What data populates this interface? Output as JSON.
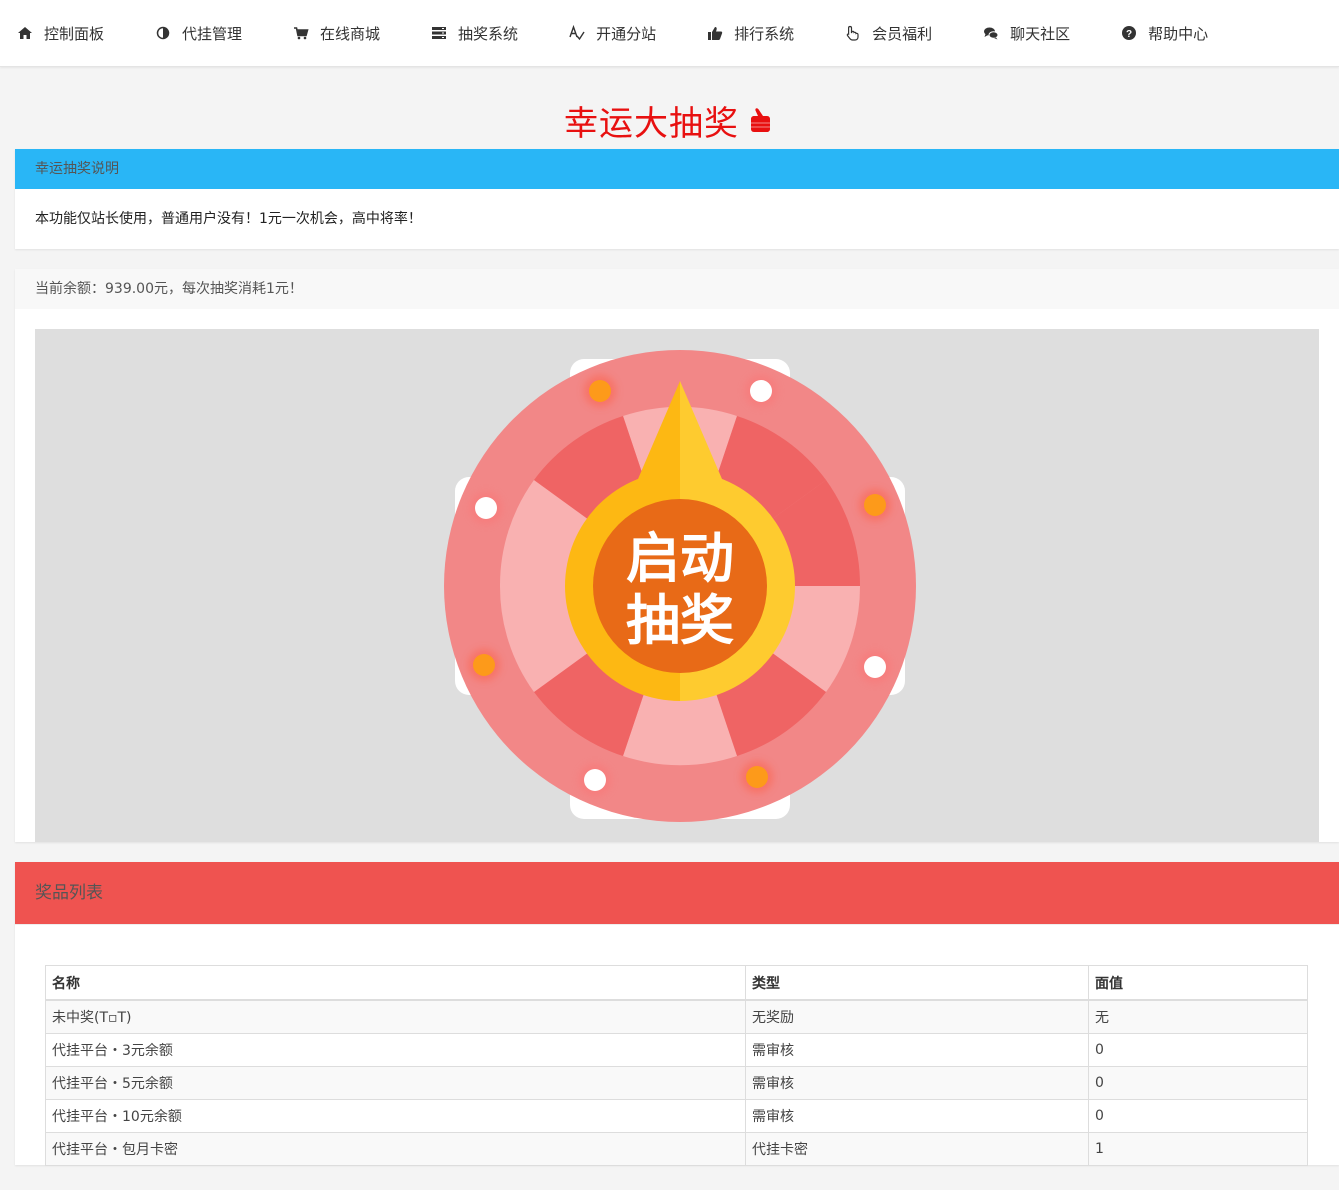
{
  "nav": [
    {
      "label": "控制面板",
      "icon": "home-icon"
    },
    {
      "label": "代挂管理",
      "icon": "contrast-icon"
    },
    {
      "label": "在线商城",
      "icon": "cart-icon"
    },
    {
      "label": "抽奖系统",
      "icon": "server-icon"
    },
    {
      "label": "开通分站",
      "icon": "text-check-icon"
    },
    {
      "label": "排行系统",
      "icon": "thumbs-up-icon"
    },
    {
      "label": "会员福利",
      "icon": "pointer-hand-icon"
    },
    {
      "label": "聊天社区",
      "icon": "chat-bubbles-icon"
    },
    {
      "label": "帮助中心",
      "icon": "question-circle-icon"
    }
  ],
  "title": "幸运大抽奖",
  "title_color": "#e81010",
  "info": {
    "heading": "幸运抽奖说明",
    "text": "本功能仅站长使用，普通用户没有！1元一次机会，高中将率！"
  },
  "balance": {
    "text": "当前余额：939.00元，每次抽奖消耗1元！"
  },
  "wheel": {
    "button_line1": "启动",
    "button_line2": "抽奖"
  },
  "prizes": {
    "heading": "奖品列表",
    "columns": [
      "名称",
      "类型",
      "面值"
    ],
    "rows": [
      [
        "未中奖(T▫T)",
        "无奖励",
        "无"
      ],
      [
        "代挂平台・3元余额",
        "需审核",
        "0"
      ],
      [
        "代挂平台・5元余额",
        "需审核",
        "0"
      ],
      [
        "代挂平台・10元余额",
        "需审核",
        "0"
      ],
      [
        "代挂平台・包月卡密",
        "代挂卡密",
        "1"
      ]
    ]
  },
  "colors": {
    "accent_blue": "#29b6f6",
    "accent_red": "#ef5350"
  }
}
